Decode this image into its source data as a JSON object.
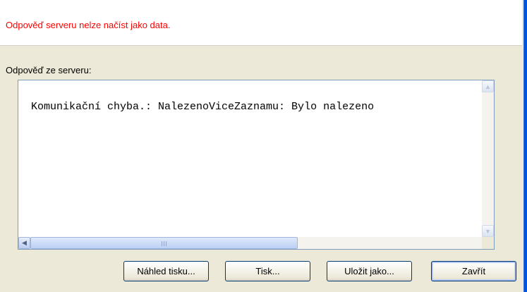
{
  "dialog": {
    "error_message": "Odpověď serveru nelze načíst jako data.",
    "response_label": "Odpověď ze serveru:",
    "response_text": "Komunikační chyba.: NalezenoViceZaznamu: Bylo nalezeno",
    "buttons": {
      "preview": "Náhled tisku...",
      "print": "Tisk...",
      "save_as": "Uložit jako...",
      "close": "Zavřít"
    }
  },
  "icons": {
    "scroll_up": "arrow-up-icon",
    "scroll_down": "arrow-down-icon",
    "scroll_left": "arrow-left-icon",
    "scroll_right": "arrow-right-icon"
  },
  "colors": {
    "error": "#ff0000",
    "window_frame": "#0054e3",
    "dialog_bg": "#ece9d8"
  }
}
